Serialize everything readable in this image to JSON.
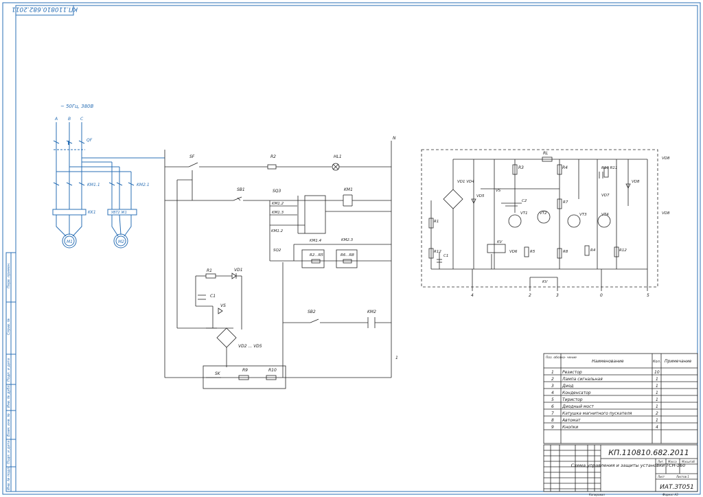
{
  "stamp_top": "КП.110810.682.2011",
  "power": {
    "supply": "~ 50Гц, 380В",
    "phases": [
      "A",
      "B",
      "C"
    ],
    "breaker": "QF",
    "contactors": [
      "KM1.1",
      "KM2.1"
    ],
    "relays": [
      "KK1",
      "УВТ2 Ж1"
    ],
    "motors": [
      "M1",
      "M2"
    ]
  },
  "control": {
    "labels": {
      "sf": "SF",
      "r2": "R2",
      "hl1": "HL1",
      "sb1": "SB1",
      "sq3": "SQ3",
      "km1_2": "KM1.2",
      "km1_3": "KM1.3",
      "km1_coil": "KM1",
      "km1_2b": "KM1.2",
      "sq2": "SQ2",
      "km1_4": "KM1.4",
      "km2_3": "KM2.3",
      "r2r5": "R2...R5",
      "r6r8": "R6...R8",
      "r1": "R1",
      "vd1": "VD1",
      "c1": "C1",
      "vs": "VS",
      "sb2": "SB2",
      "km2": "KM2",
      "vd2": "VD2 ... VD5",
      "sk": "SK",
      "r9": "R9",
      "r10": "R10",
      "n": "N",
      "one": "1"
    }
  },
  "sensor": {
    "labels": {
      "rl": "RL",
      "r3": "R3",
      "r4": "R4",
      "r10r11": "R10 R11",
      "vd8": "VD8",
      "vd1vd4": "VD1 VD4",
      "vd5": "VD5",
      "vs": "VS",
      "c2": "C2",
      "vt1": "VT1",
      "vt2": "VT2",
      "r7": "R7",
      "vd7": "VD7",
      "vt3": "VT3",
      "vt4": "VT4",
      "r1": "R1",
      "kv": "KV",
      "vd6": "VD6",
      "r5": "R5",
      "r8": "R8",
      "r4b": "R4",
      "r12": "R12",
      "c1": "C1",
      "r1b": "R12",
      "kv2": "KV",
      "vd9": "VD8",
      "vd10": "VD8"
    },
    "terminals": [
      "4",
      "2",
      "3",
      "0",
      "5"
    ]
  },
  "bom": {
    "headers": [
      "Поз. обозна- чение",
      "Наименование",
      "Кол.",
      "Примечание"
    ],
    "rows": [
      {
        "pos": "1",
        "name": "Резистор",
        "qty": "10"
      },
      {
        "pos": "2",
        "name": "Лампа сигнальная",
        "qty": "1"
      },
      {
        "pos": "3",
        "name": "Диод",
        "qty": "1"
      },
      {
        "pos": "4",
        "name": "Конденсатор",
        "qty": "1"
      },
      {
        "pos": "5",
        "name": "Тиристор",
        "qty": "1"
      },
      {
        "pos": "6",
        "name": "Диодный мост",
        "qty": "1"
      },
      {
        "pos": "7",
        "name": "Катушка магнитного пускателя",
        "qty": "2"
      },
      {
        "pos": "8",
        "name": "Автомат",
        "qty": "1"
      },
      {
        "pos": "9",
        "name": "Кнопки",
        "qty": "4"
      }
    ]
  },
  "title_block": {
    "code": "КП.110810.682.2011",
    "title": "Схема управления и защиты установки ТСН-160",
    "org": "ИАТ.ЗТ051",
    "lit": "Лит.",
    "mass": "Масса",
    "scale": "Масштаб",
    "sheet": "Лист",
    "sheets": "Листов 1",
    "copied": "Копировал",
    "format": "Формат A3"
  },
  "side_labels": [
    "Перв. примен.",
    "Справ. №",
    "Подп. и дата",
    "Инв. № дубл.",
    "Взам. инв. №",
    "Подп. и дата",
    "Инв. № подл."
  ]
}
